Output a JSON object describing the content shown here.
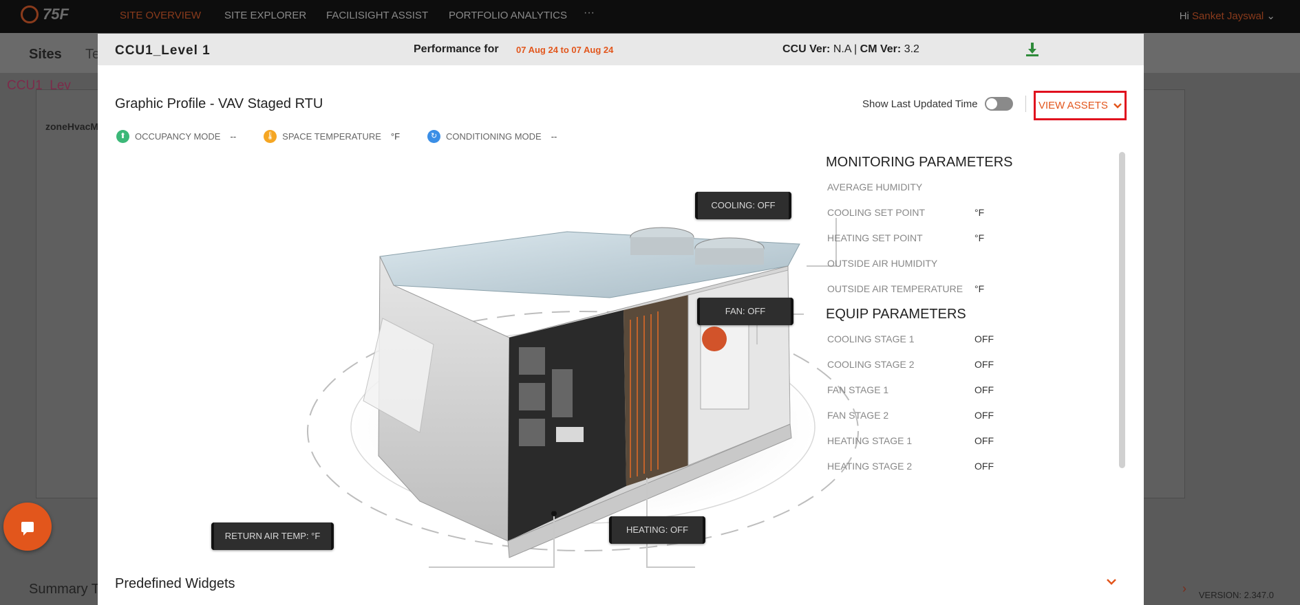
{
  "app": {
    "logo_text": "75F",
    "nav": [
      "SITE OVERVIEW",
      "SITE EXPLORER",
      "FACILISIGHT ASSIST",
      "PORTFOLIO ANALYTICS"
    ],
    "nav_more": "···",
    "greeting": "Hi",
    "user_name": "Sanket Jayswal"
  },
  "background": {
    "sites_label": "Sites",
    "sites_tab": "Te",
    "ccu_label": "CCU1_Lev",
    "zone_label": "zoneHvacM",
    "summary_label": "Summary T",
    "version": "VERSION: 2.347.0"
  },
  "modal": {
    "title": "CCU1_Level 1",
    "performance_label": "Performance for",
    "date_range": "07 Aug 24 to 07 Aug 24",
    "ccu_ver_label": "CCU Ver:",
    "ccu_ver_value": "N.A",
    "cm_ver_label": "CM Ver:",
    "cm_ver_value": "3.2",
    "graphic_title": "Graphic Profile - VAV Staged RTU",
    "show_last_updated": "Show Last Updated Time",
    "show_last_updated_on": false,
    "view_assets": "VIEW ASSETS",
    "modes": [
      {
        "label": "OCCUPANCY MODE",
        "value": "--",
        "color": "#3cb878"
      },
      {
        "label": "SPACE TEMPERATURE",
        "value": "°F",
        "color": "#f5a623"
      },
      {
        "label": "CONDITIONING MODE",
        "value": "--",
        "color": "#3a8ee6"
      }
    ],
    "callouts": {
      "cooling": "COOLING: OFF",
      "fan": "FAN: OFF",
      "heating": "HEATING: OFF",
      "return_air": "RETURN AIR TEMP: °F"
    },
    "monitoring": {
      "heading": "MONITORING PARAMETERS",
      "rows": [
        {
          "label": "AVERAGE HUMIDITY",
          "value": ""
        },
        {
          "label": "COOLING SET POINT",
          "value": "°F"
        },
        {
          "label": "HEATING SET POINT",
          "value": "°F"
        },
        {
          "label": "OUTSIDE AIR HUMIDITY",
          "value": ""
        },
        {
          "label": "OUTSIDE AIR TEMPERATURE",
          "value": "°F"
        }
      ]
    },
    "equip": {
      "heading": "EQUIP PARAMETERS",
      "rows": [
        {
          "label": "COOLING STAGE 1",
          "value": "OFF"
        },
        {
          "label": "COOLING STAGE 2",
          "value": "OFF"
        },
        {
          "label": "FAN STAGE 1",
          "value": "OFF"
        },
        {
          "label": "FAN STAGE 2",
          "value": "OFF"
        },
        {
          "label": "HEATING STAGE 1",
          "value": "OFF"
        },
        {
          "label": "HEATING STAGE 2",
          "value": "OFF"
        }
      ]
    },
    "predefined_widgets": "Predefined Widgets"
  },
  "colors": {
    "accent": "#e2561c",
    "highlight_border": "#e0101e",
    "download_icon": "#2e8b3a"
  }
}
